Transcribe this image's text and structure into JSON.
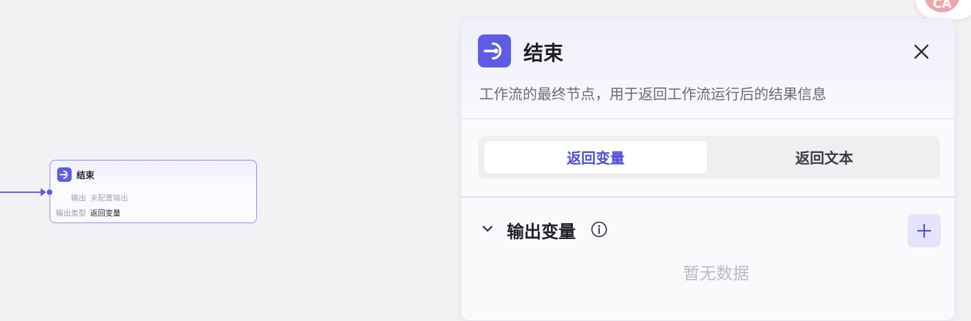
{
  "colors": {
    "accent": "#5e5ce6",
    "active_tab_text": "#4f4dd6",
    "add_button_bg": "#e4e3fb",
    "avatar_bg": "#f0a5ac"
  },
  "node": {
    "icon": "end-node-icon",
    "title": "结束",
    "output_label": "输出",
    "output_value": "未配置输出",
    "output_type_label": "输出类型",
    "output_type_value": "返回变量"
  },
  "avatar": {
    "initials": "CA"
  },
  "panel": {
    "icon": "end-node-icon",
    "title": "结束",
    "description": "工作流的最终节点，用于返回工作流运行后的结果信息",
    "close_icon": "close-icon",
    "tabs": [
      {
        "label": "返回变量",
        "active": true
      },
      {
        "label": "返回文本",
        "active": false
      }
    ],
    "section": {
      "title": "输出变量",
      "toggle_icon": "chevron-down-icon",
      "info_icon": "info-icon",
      "add_icon": "plus-icon",
      "empty_text": "暂无数据"
    }
  }
}
